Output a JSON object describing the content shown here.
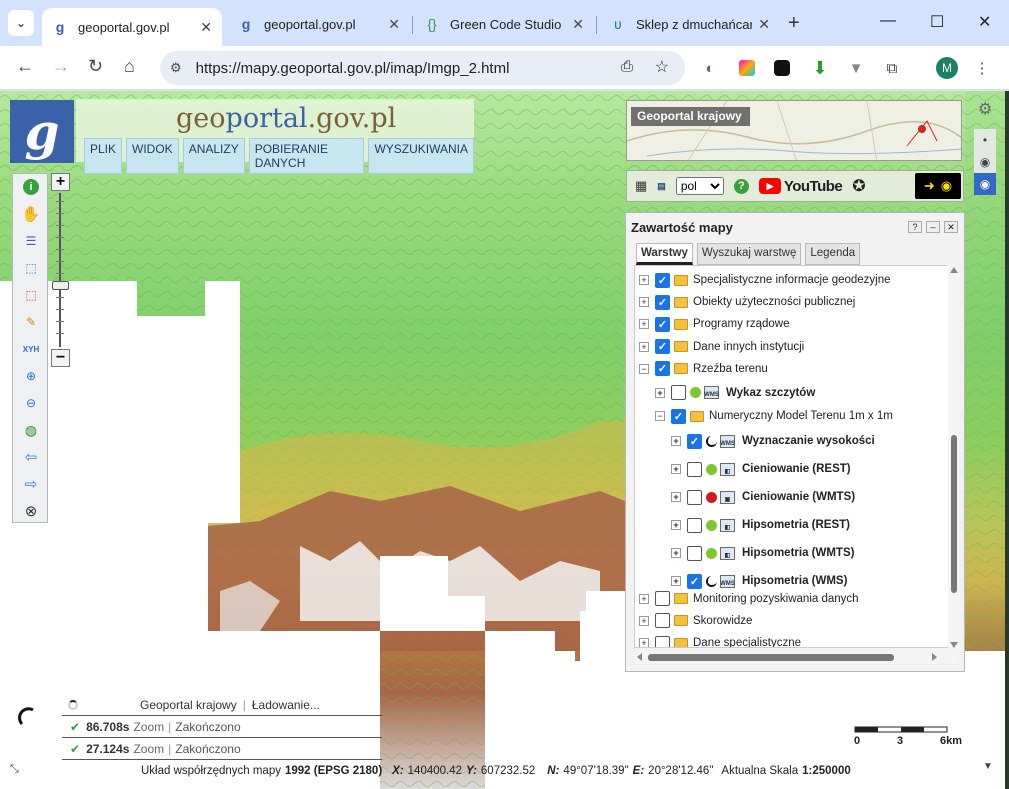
{
  "browser": {
    "tabs": [
      {
        "title": "geoportal.gov.pl",
        "icon": "geoportal-favicon",
        "active": true
      },
      {
        "title": "geoportal.gov.pl",
        "icon": "geoportal-favicon",
        "active": false
      },
      {
        "title": "Green Code Studio",
        "icon": "code-braces-icon",
        "active": false
      },
      {
        "title": "Sklep z dmuchańcami",
        "icon": "shop-favicon",
        "active": false
      }
    ],
    "url": "https://mapy.geoportal.gov.pl/imap/Imgp_2.html",
    "avatar_letter": "M"
  },
  "header": {
    "site_name_g": "g",
    "site_name_eo": "eo",
    "site_name_portal": "portal",
    "site_name_domain": ".gov.pl",
    "menu": [
      "PLIK",
      "WIDOK",
      "ANALIZY",
      "POBIERANIE DANYCH",
      "WYSZUKIWANIA"
    ]
  },
  "overview": {
    "label": "Geoportal krajowy"
  },
  "quick_toolbar": {
    "language": "pol",
    "youtube": "YouTube"
  },
  "panel": {
    "title": "Zawartość mapy",
    "tabs": [
      "Warstwy",
      "Wyszukaj warstwę",
      "Legenda"
    ],
    "layers": [
      {
        "label": "Specjalistyczne informacje geodezyjne",
        "level": 0,
        "expander": "+",
        "checked": true,
        "kind": "folder",
        "bold": false
      },
      {
        "label": "Obiekty użyteczności publicznej",
        "level": 0,
        "expander": "+",
        "checked": true,
        "kind": "folder",
        "bold": false
      },
      {
        "label": "Programy rządowe",
        "level": 0,
        "expander": "+",
        "checked": true,
        "kind": "folder",
        "bold": false
      },
      {
        "label": "Dane innych instytucji",
        "level": 0,
        "expander": "+",
        "checked": true,
        "kind": "folder",
        "bold": false
      },
      {
        "label": "Rzeźba terenu",
        "level": 0,
        "expander": "−",
        "checked": true,
        "kind": "folder",
        "bold": false
      },
      {
        "label": "Wykaz szczytów",
        "level": 1,
        "expander": "+",
        "checked": false,
        "kind": "wms",
        "status": "green",
        "bold": true
      },
      {
        "label": "Numeryczny Model Terenu 1m x 1m",
        "level": 1,
        "expander": "−",
        "checked": true,
        "kind": "folder",
        "bold": false
      },
      {
        "label": "Wyznaczanie wysokości",
        "level": 2,
        "expander": "+",
        "checked": true,
        "kind": "wms",
        "status": "loading",
        "bold": true
      },
      {
        "label": "Cieniowanie (REST)",
        "level": 2,
        "expander": "+",
        "checked": false,
        "kind": "rest",
        "status": "green",
        "bold": true
      },
      {
        "label": "Cieniowanie (WMTS)",
        "level": 2,
        "expander": "+",
        "checked": false,
        "kind": "wmts",
        "status": "red",
        "bold": true
      },
      {
        "label": "Hipsometria (REST)",
        "level": 2,
        "expander": "+",
        "checked": false,
        "kind": "rest",
        "status": "green",
        "bold": true
      },
      {
        "label": "Hipsometria (WMTS)",
        "level": 2,
        "expander": "+",
        "checked": false,
        "kind": "rest",
        "status": "green",
        "bold": true
      },
      {
        "label": "Hipsometria (WMS)",
        "level": 2,
        "expander": "+",
        "checked": true,
        "kind": "wms",
        "status": "loading",
        "bold": true
      },
      {
        "label": "Monitoring pozyskiwania danych",
        "level": 0,
        "expander": "+",
        "checked": false,
        "kind": "folder",
        "bold": false
      },
      {
        "label": "Skorowidze",
        "level": 0,
        "expander": "+",
        "checked": false,
        "kind": "folder",
        "bold": false
      },
      {
        "label": "Dane specjalistyczne",
        "level": 0,
        "expander": "+",
        "checked": false,
        "kind": "folder",
        "bold": false
      }
    ]
  },
  "loading": {
    "rows": [
      {
        "time": "",
        "name": "Geoportal krajowy",
        "status": "Ładowanie..."
      },
      {
        "time": "86.708s",
        "name": "Zoom",
        "status": "Zakończono"
      },
      {
        "time": "27.124s",
        "name": "Zoom",
        "status": "Zakończono"
      }
    ]
  },
  "scale": {
    "ticks": [
      "0",
      "3",
      "6km"
    ]
  },
  "status": {
    "crs_label": "Układ współrzędnych mapy",
    "crs_value": "1992 (EPSG 2180)",
    "x_label": "X:",
    "x_value": "140400.42",
    "y_label": "Y:",
    "y_value": "607232.52",
    "n_label": "N:",
    "n_value": "49°07'18.39\"",
    "e_label": "E:",
    "e_value": "20°28'12.46\"",
    "scale_label": "Aktualna Skala",
    "scale_value": "1:250000"
  }
}
